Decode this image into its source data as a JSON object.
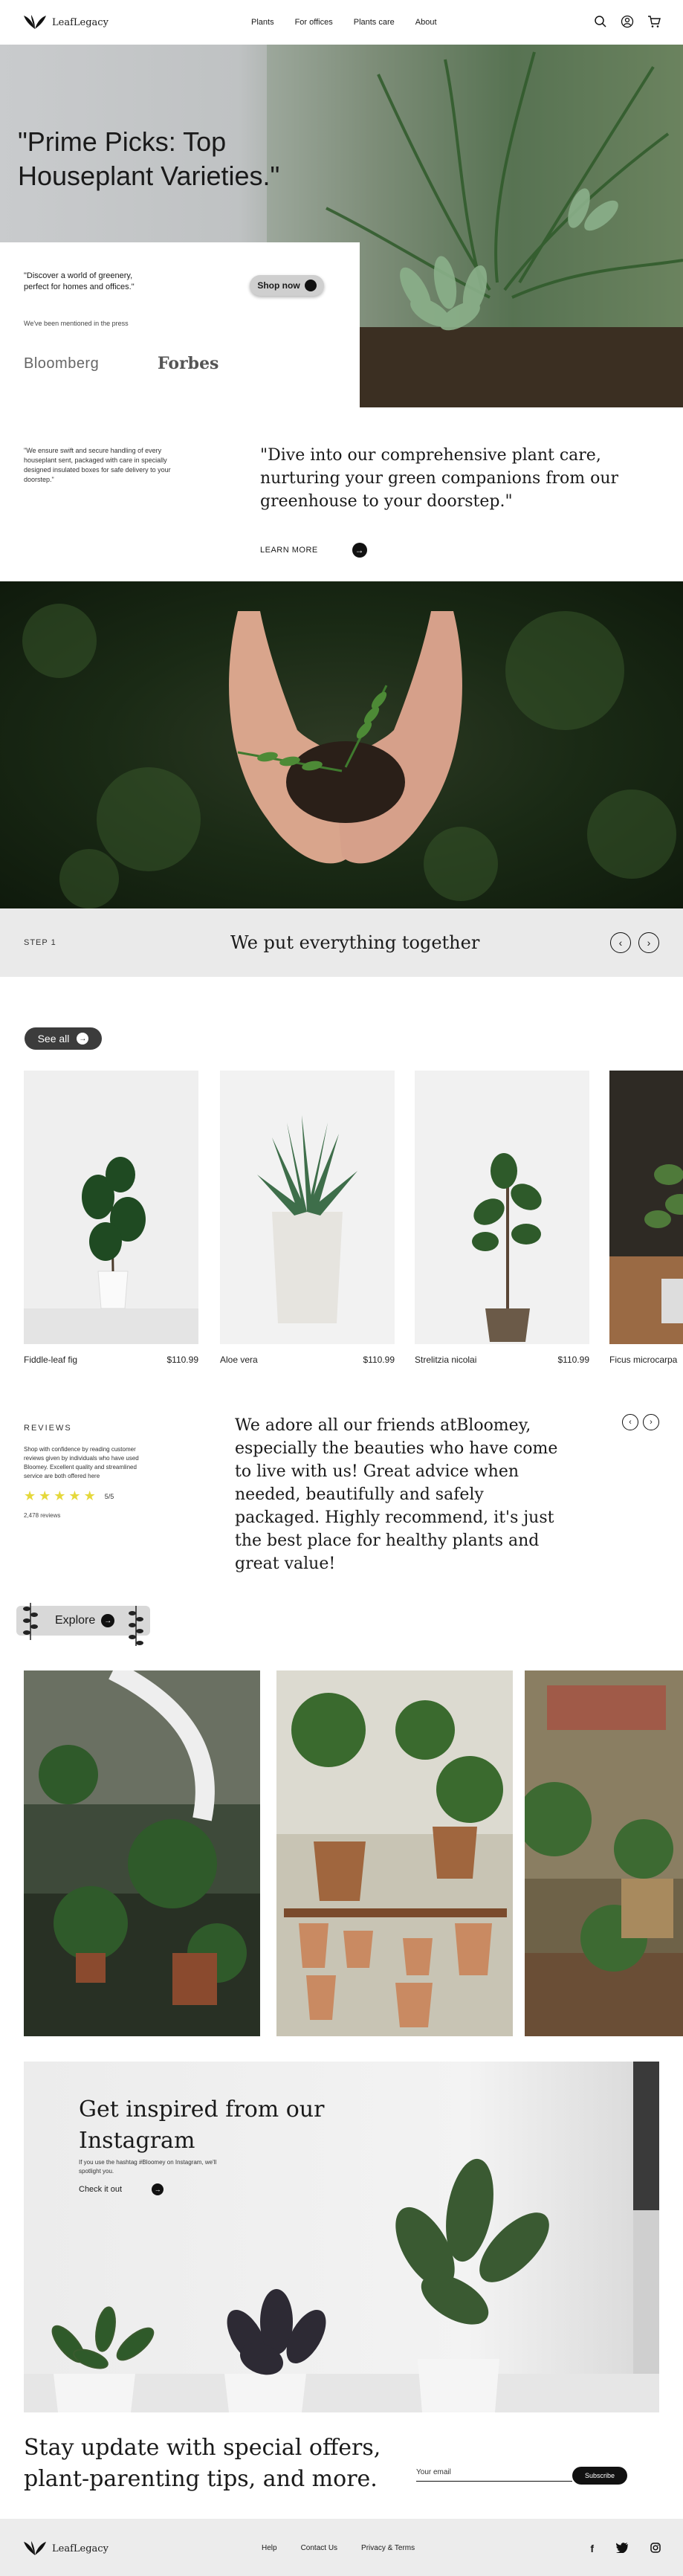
{
  "header": {
    "logo_text": "LeafLegacy",
    "nav": [
      "Plants",
      "For offices",
      "Plants care",
      "About"
    ],
    "icons": [
      "search-icon",
      "user-icon",
      "cart-icon"
    ]
  },
  "hero": {
    "title": "\"Prime Picks: Top Houseplant Varieties.\"",
    "description": "\"Discover a world of greenery, perfect for homes and offices.\"",
    "shop_now": "Shop now",
    "mentioned": "We've been mentioned in the press",
    "brands": [
      "Bloomberg",
      "Forbes"
    ]
  },
  "care": {
    "left_text": "\"We ensure swift and secure handling of every houseplant sent, packaged with care in specially designed insulated boxes for safe delivery to your doorstep.\"",
    "quote": "\"Dive into our comprehensive plant care, nurturing your green companions from our greenhouse to your doorstep.\"",
    "learn_more": "LEARN MORE"
  },
  "step": {
    "label": "STEP 1",
    "title": "We put everything together"
  },
  "products": {
    "see_all": "See all",
    "items": [
      {
        "name": "Fiddle-leaf fig",
        "price": "$110.99"
      },
      {
        "name": "Aloe vera",
        "price": "$110.99"
      },
      {
        "name": "Strelitzia nicolai",
        "price": "$110.99"
      },
      {
        "name": "Ficus microcarpa",
        "price": ""
      }
    ]
  },
  "reviews": {
    "label": "REVIEWS",
    "text": "Shop with confidence by reading customer reviews given by individuals who have used Bloomey. Excellent quality and streamlined service are both offered here",
    "rating": 5,
    "score": "5/5",
    "count": "2,478 reviews",
    "quote": "We adore all our friends atBloomey, especially the beauties who have come to live with us! Great advice when needed, beautifully and safely packaged. Highly recommend, it's just the best place for healthy plants and great value!"
  },
  "explore": {
    "label": "Explore"
  },
  "instagram": {
    "title": "Get inspired from our Instagram",
    "subtitle": "If you use the hashtag #Bloomey on Instagram, we'll spotlight you.",
    "check_out": "Check it out"
  },
  "newsletter": {
    "title": "Stay update with special offers, plant-parenting tips, and more.",
    "email_placeholder": "Your email",
    "subscribe": "Subscribe"
  },
  "footer": {
    "logo_text": "LeafLegacy",
    "links": [
      "Help",
      "Contact Us",
      "Privacy & Terms"
    ],
    "social": [
      "f",
      "twitter-icon",
      "instagram-icon"
    ]
  }
}
